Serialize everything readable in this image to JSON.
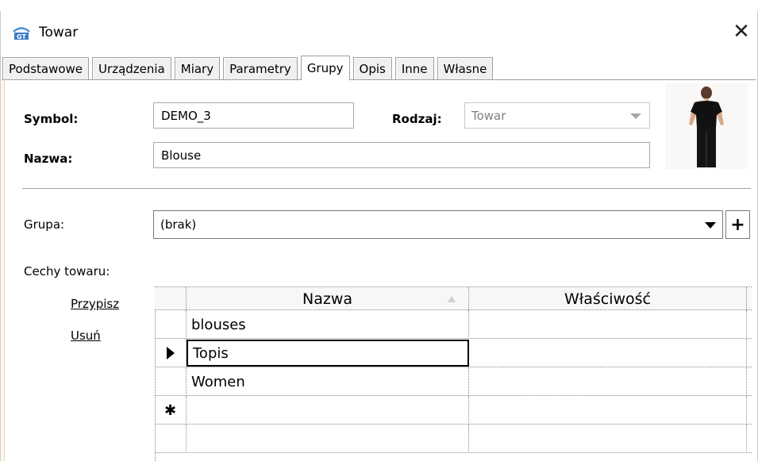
{
  "window": {
    "title": "Towar",
    "close_glyph": "✕"
  },
  "tabs": [
    {
      "label": "Podstawowe"
    },
    {
      "label": "Urządzenia"
    },
    {
      "label": "Miary"
    },
    {
      "label": "Parametry"
    },
    {
      "label": "Grupy",
      "active": true
    },
    {
      "label": "Opis"
    },
    {
      "label": "Inne"
    },
    {
      "label": "Własne"
    }
  ],
  "form": {
    "symbol_label": "Symbol:",
    "symbol_value": "DEMO_3",
    "rodzaj_label": "Rodzaj:",
    "rodzaj_value": "Towar",
    "nazwa_label": "Nazwa:",
    "nazwa_value": "Blouse",
    "grupa_label": "Grupa:",
    "grupa_value": "(brak)",
    "plus_label": "+",
    "cechy_label": "Cechy towaru:"
  },
  "links": {
    "assign": "Przypisz",
    "remove": "Usuń"
  },
  "grid": {
    "columns": [
      "Nazwa",
      "Właściwość"
    ],
    "rows": [
      {
        "nazwa": "blouses",
        "wlasciwosc": ""
      },
      {
        "nazwa": "Topis",
        "wlasciwosc": "",
        "current": true
      },
      {
        "nazwa": "Women",
        "wlasciwosc": ""
      }
    ],
    "new_row_marker": "✱"
  },
  "icons": {
    "app": "app-logo-icon",
    "close": "close-icon",
    "dropdown": "chevron-down-icon",
    "current_row": "row-pointer-icon",
    "new_row": "asterisk-icon",
    "sort": "sort-ascending-icon"
  }
}
